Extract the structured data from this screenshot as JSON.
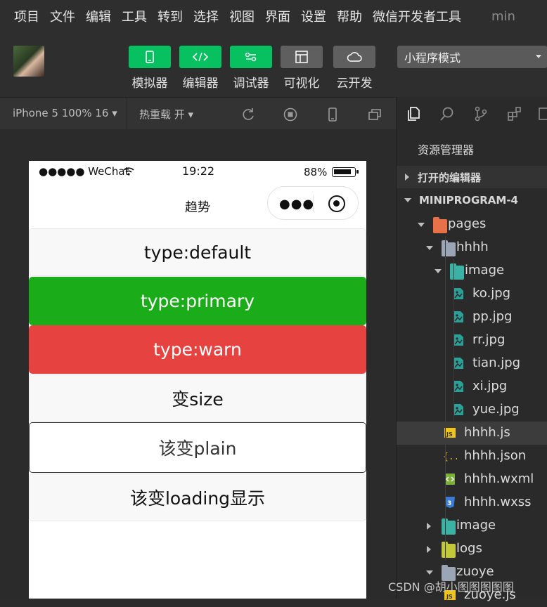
{
  "menu": [
    "项目",
    "文件",
    "编辑",
    "工具",
    "转到",
    "选择",
    "视图",
    "界面",
    "设置",
    "帮助",
    "微信开发者工具"
  ],
  "menu_right": "min",
  "toolbar": {
    "buttons": [
      {
        "label": "模拟器",
        "icon": "phone-icon"
      },
      {
        "label": "编辑器",
        "icon": "code-icon"
      },
      {
        "label": "调试器",
        "icon": "debug-icon"
      },
      {
        "label": "可视化",
        "icon": "layout-icon"
      },
      {
        "label": "云开发",
        "icon": "cloud-icon"
      }
    ],
    "mode": "小程序模式"
  },
  "subbar": {
    "device": "iPhone 5 100% 16 ▾",
    "hot_reload": "热重载 开 ▾"
  },
  "phone": {
    "carrier": "●●●●● WeChat",
    "time": "19:22",
    "battery": "88%",
    "title": "趋势",
    "capsule_dots": "●●●",
    "buttons": [
      {
        "label": "type:default",
        "style": "default"
      },
      {
        "label": "type:primary",
        "style": "primary"
      },
      {
        "label": "type:warn",
        "style": "warn"
      },
      {
        "label": "变size",
        "style": "default"
      },
      {
        "label": "该变plain",
        "style": "plain"
      },
      {
        "label": "该变loading显示",
        "style": "default"
      }
    ]
  },
  "explorer": {
    "title": "资源管理器",
    "open_editors": "打开的编辑器",
    "project": "MINIPROGRAM-4",
    "tree": [
      {
        "label": "pages",
        "type": "folder-pages",
        "depth": 0,
        "open": true
      },
      {
        "label": "hhhh",
        "type": "folder",
        "depth": 1,
        "open": true
      },
      {
        "label": "image",
        "type": "folder-image",
        "depth": 2,
        "open": true
      },
      {
        "label": "ko.jpg",
        "type": "image",
        "depth": 3
      },
      {
        "label": "pp.jpg",
        "type": "image",
        "depth": 3
      },
      {
        "label": "rr.jpg",
        "type": "image",
        "depth": 3
      },
      {
        "label": "tian.jpg",
        "type": "image",
        "depth": 3
      },
      {
        "label": "xi.jpg",
        "type": "image",
        "depth": 3
      },
      {
        "label": "yue.jpg",
        "type": "image",
        "depth": 3
      },
      {
        "label": "hhhh.js",
        "type": "js",
        "depth": 2,
        "active": true
      },
      {
        "label": "hhhh.json",
        "type": "json",
        "depth": 2
      },
      {
        "label": "hhhh.wxml",
        "type": "wxml",
        "depth": 2
      },
      {
        "label": "hhhh.wxss",
        "type": "wxss",
        "depth": 2
      },
      {
        "label": "image",
        "type": "folder-image",
        "depth": 1,
        "open": false
      },
      {
        "label": "logs",
        "type": "folder-logs",
        "depth": 1,
        "open": false
      },
      {
        "label": "zuoye",
        "type": "folder",
        "depth": 1,
        "open": true
      },
      {
        "label": "zuoye.js",
        "type": "js",
        "depth": 2
      }
    ]
  },
  "watermark": "CSDN @胡小图图图图图",
  "colors": {
    "accent_green": "#07c160",
    "primary": "#1aad19",
    "warn": "#e64340"
  }
}
